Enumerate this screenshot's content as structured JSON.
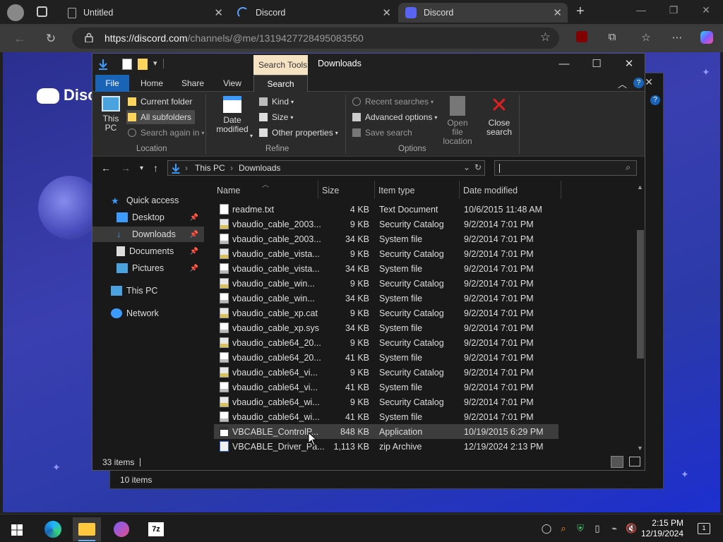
{
  "browser": {
    "tabs": [
      {
        "label": "Untitled"
      },
      {
        "label": "Discord"
      },
      {
        "label": "Discord"
      }
    ],
    "url_host": "https://discord.com",
    "url_path": "/channels/@me/1319427728495083550"
  },
  "discord": {
    "brand": "Disco"
  },
  "back_window": {
    "status": "10 items"
  },
  "explorer": {
    "title": "Downloads",
    "context_tab_group": "Search Tools",
    "ribbon_tabs": [
      "File",
      "Home",
      "Share",
      "View",
      "Search"
    ],
    "ribbon": {
      "location": {
        "label": "Location",
        "this_pc": "This PC",
        "current_folder": "Current folder",
        "all_subfolders": "All subfolders",
        "search_again": "Search again in"
      },
      "refine": {
        "label": "Refine",
        "date_modified": "Date modified",
        "kind": "Kind",
        "size": "Size",
        "other_properties": "Other properties"
      },
      "options": {
        "label": "Options",
        "recent_searches": "Recent searches",
        "advanced_options": "Advanced options",
        "save_search": "Save search",
        "open_file_location": "Open file location",
        "close_search": "Close search"
      }
    },
    "breadcrumb": [
      "This PC",
      "Downloads"
    ],
    "search_value": "",
    "nav": [
      {
        "label": "Quick access",
        "pinned": false
      },
      {
        "label": "Desktop",
        "pinned": true
      },
      {
        "label": "Downloads",
        "pinned": true
      },
      {
        "label": "Documents",
        "pinned": true
      },
      {
        "label": "Pictures",
        "pinned": true
      },
      {
        "label": "This PC",
        "pinned": false
      },
      {
        "label": "Network",
        "pinned": false
      }
    ],
    "columns": [
      "Name",
      "Size",
      "Item type",
      "Date modified"
    ],
    "files": [
      {
        "name": "readme.txt",
        "size": "4 KB",
        "type": "Text Document",
        "date": "10/6/2015 11:48 AM",
        "icon": "text-file"
      },
      {
        "name": "vbaudio_cable_2003...",
        "size": "9 KB",
        "type": "Security Catalog",
        "date": "9/2/2014 7:01 PM",
        "icon": "catalog-file"
      },
      {
        "name": "vbaudio_cable_2003...",
        "size": "34 KB",
        "type": "System file",
        "date": "9/2/2014 7:01 PM",
        "icon": "system-file"
      },
      {
        "name": "vbaudio_cable_vista...",
        "size": "9 KB",
        "type": "Security Catalog",
        "date": "9/2/2014 7:01 PM",
        "icon": "catalog-file"
      },
      {
        "name": "vbaudio_cable_vista...",
        "size": "34 KB",
        "type": "System file",
        "date": "9/2/2014 7:01 PM",
        "icon": "system-file"
      },
      {
        "name": "vbaudio_cable_win...",
        "size": "9 KB",
        "type": "Security Catalog",
        "date": "9/2/2014 7:01 PM",
        "icon": "catalog-file"
      },
      {
        "name": "vbaudio_cable_win...",
        "size": "34 KB",
        "type": "System file",
        "date": "9/2/2014 7:01 PM",
        "icon": "system-file"
      },
      {
        "name": "vbaudio_cable_xp.cat",
        "size": "9 KB",
        "type": "Security Catalog",
        "date": "9/2/2014 7:01 PM",
        "icon": "catalog-file"
      },
      {
        "name": "vbaudio_cable_xp.sys",
        "size": "34 KB",
        "type": "System file",
        "date": "9/2/2014 7:01 PM",
        "icon": "system-file"
      },
      {
        "name": "vbaudio_cable64_20...",
        "size": "9 KB",
        "type": "Security Catalog",
        "date": "9/2/2014 7:01 PM",
        "icon": "catalog-file"
      },
      {
        "name": "vbaudio_cable64_20...",
        "size": "41 KB",
        "type": "System file",
        "date": "9/2/2014 7:01 PM",
        "icon": "system-file"
      },
      {
        "name": "vbaudio_cable64_vi...",
        "size": "9 KB",
        "type": "Security Catalog",
        "date": "9/2/2014 7:01 PM",
        "icon": "catalog-file"
      },
      {
        "name": "vbaudio_cable64_vi...",
        "size": "41 KB",
        "type": "System file",
        "date": "9/2/2014 7:01 PM",
        "icon": "system-file"
      },
      {
        "name": "vbaudio_cable64_wi...",
        "size": "9 KB",
        "type": "Security Catalog",
        "date": "9/2/2014 7:01 PM",
        "icon": "catalog-file"
      },
      {
        "name": "vbaudio_cable64_wi...",
        "size": "41 KB",
        "type": "System file",
        "date": "9/2/2014 7:01 PM",
        "icon": "system-file"
      },
      {
        "name": "VBCABLE_ControlP...",
        "size": "848 KB",
        "type": "Application",
        "date": "10/19/2015 6:29 PM",
        "icon": "application-file"
      },
      {
        "name": "VBCABLE_Driver_Pa...",
        "size": "1,113 KB",
        "type": "zip Archive",
        "date": "12/19/2024 2:13 PM",
        "icon": "zip-file"
      }
    ],
    "hovered_row": 15,
    "status": "33 items"
  },
  "taskbar": {
    "time": "2:15 PM",
    "date": "12/19/2024",
    "notification_count": "1"
  },
  "colors": {
    "accent": "#1a64b7",
    "context_tab": "#f6e3c4",
    "discord_blurple": "#3a3fb0"
  }
}
